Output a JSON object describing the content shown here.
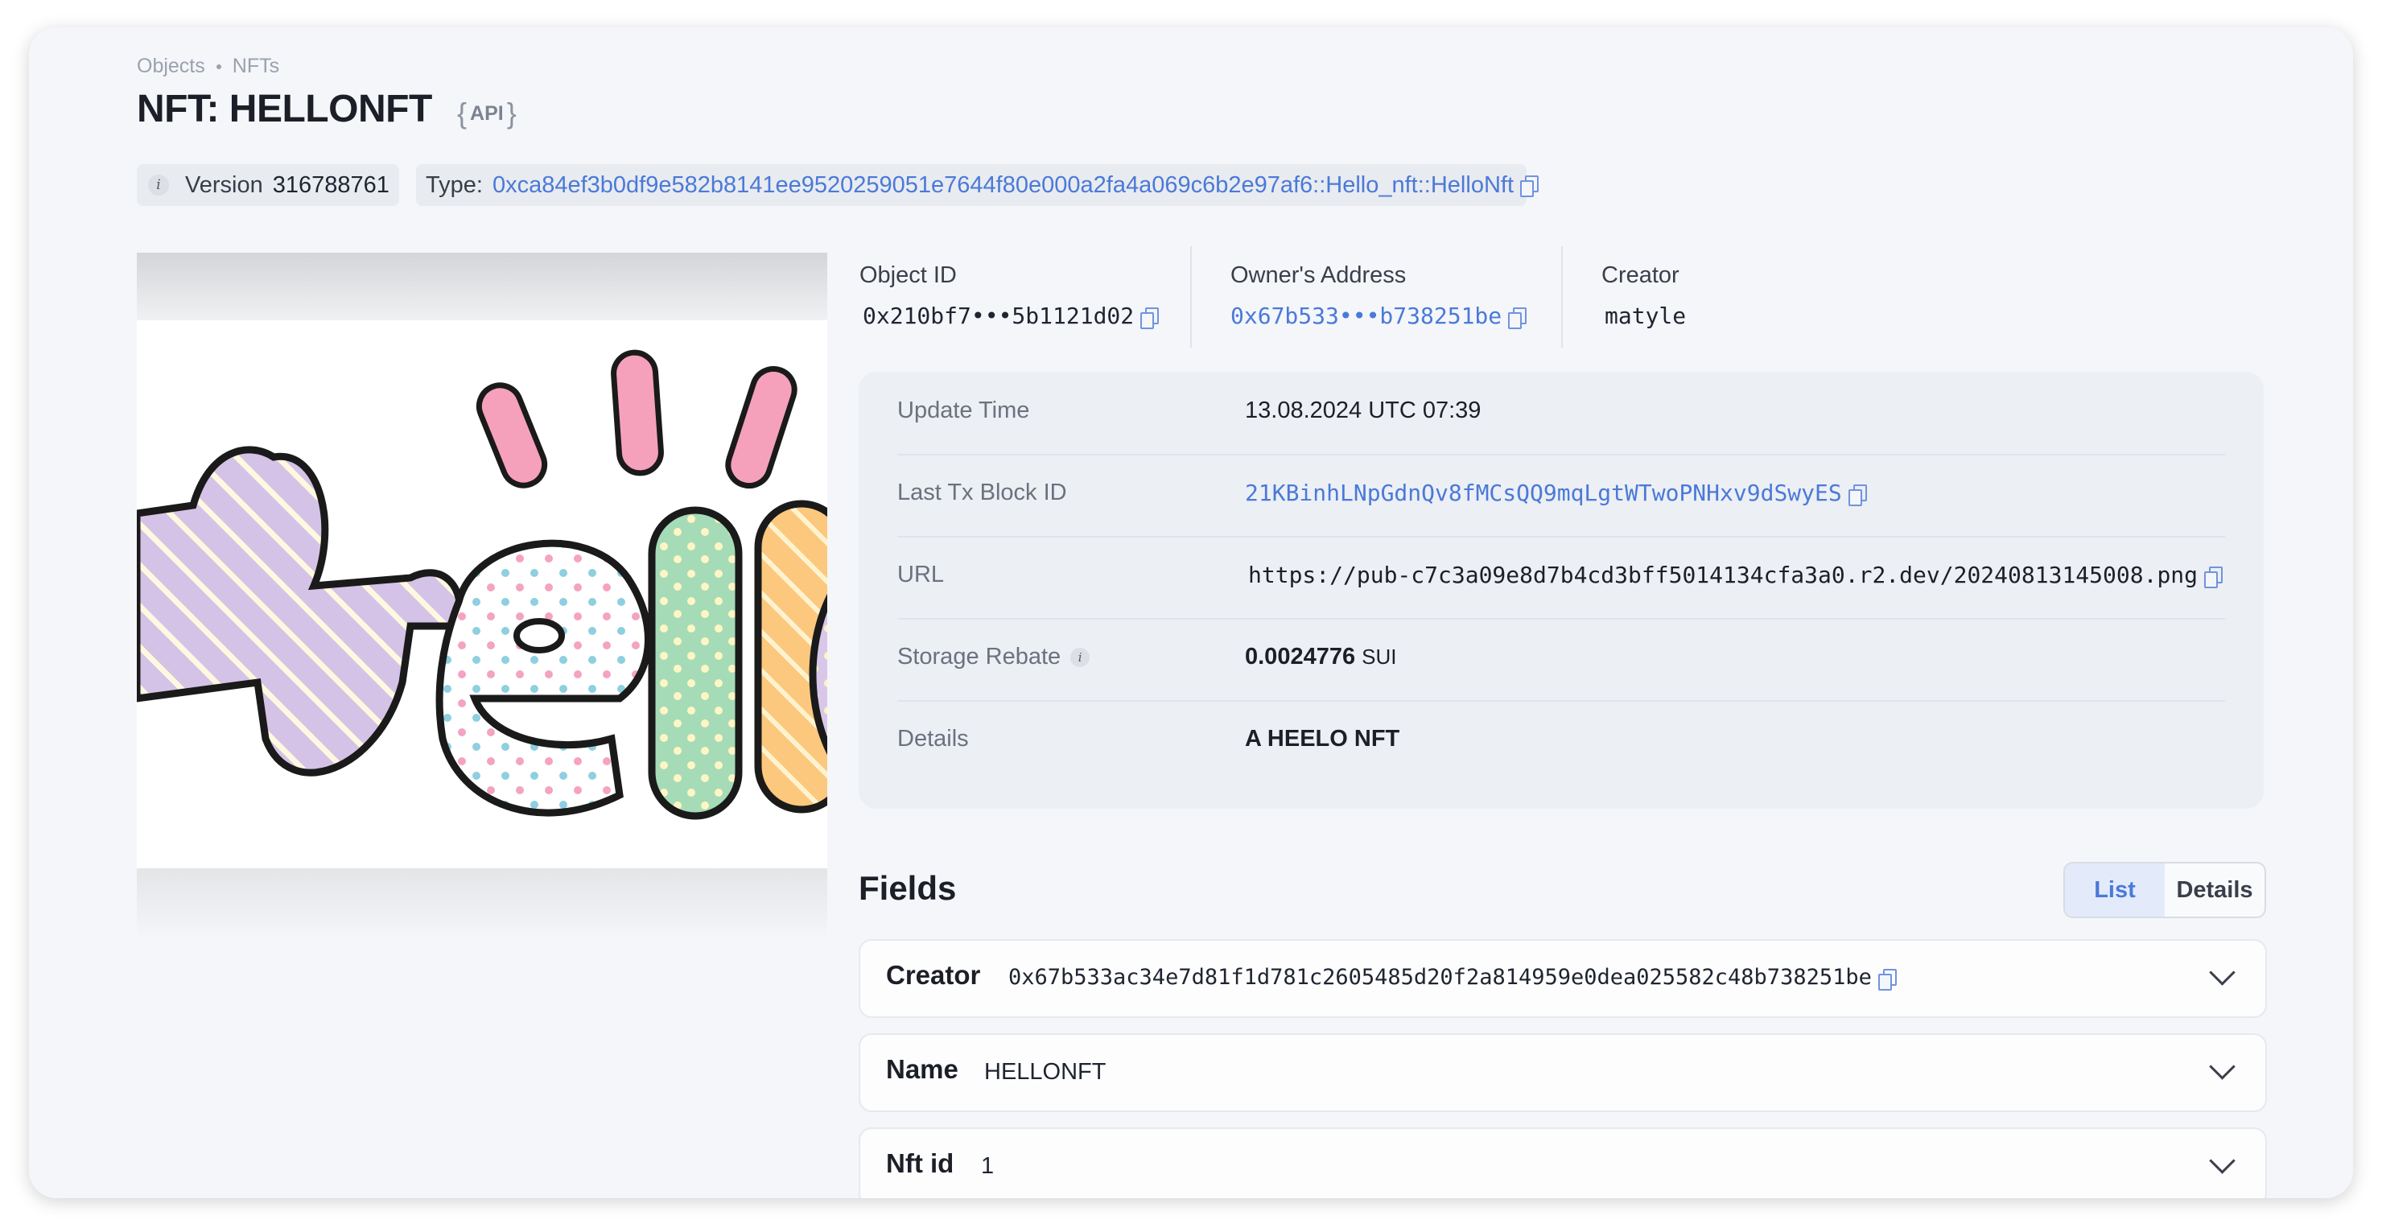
{
  "breadcrumb": {
    "items": [
      "Objects",
      "NFTs"
    ]
  },
  "page": {
    "title": "NFT: HELLONFT",
    "api_label": "API"
  },
  "version": {
    "label": "Version",
    "value": "316788761"
  },
  "type": {
    "label": "Type:",
    "value": "0xca84ef3b0df9e582b8141ee9520259051e7644f80e000a2fa4a069c6b2e97af6::Hello_nft::HelloNft"
  },
  "summary": {
    "object_id": {
      "label": "Object ID",
      "value": "0x210bf7•••5b1121d02"
    },
    "owner": {
      "label": "Owner's Address",
      "value": "0x67b533•••b738251be"
    },
    "creator": {
      "label": "Creator",
      "value": "matyle"
    }
  },
  "details": {
    "update_time": {
      "label": "Update Time",
      "value": "13.08.2024 UTC 07:39"
    },
    "last_tx": {
      "label": "Last Tx Block ID",
      "value": "21KBinhLNpGdnQv8fMCsQQ9mqLgtWTwoPNHxv9dSwyES"
    },
    "url": {
      "label": "URL",
      "value": "https://pub-c7c3a09e8d7b4cd3bff5014134cfa3a0.r2.dev/20240813145008.png"
    },
    "storage_rebate": {
      "label": "Storage Rebate",
      "value": "0.0024776",
      "unit": "SUI"
    },
    "details": {
      "label": "Details",
      "value": "A HEELO NFT"
    }
  },
  "fields": {
    "title": "Fields",
    "toggle": {
      "list": "List",
      "details": "Details",
      "selected": "List"
    },
    "items": [
      {
        "key": "Creator",
        "value": "0x67b533ac34e7d81f1d781c2605485d20f2a814959e0dea025582c48b738251be"
      },
      {
        "key": "Name",
        "value": "HELLONFT"
      },
      {
        "key": "Nft id",
        "value": "1"
      }
    ]
  },
  "icons": [
    "info-icon",
    "copy-icon",
    "chevron-down-icon"
  ],
  "colors": {
    "link": "#4b79d8",
    "background": "#f4f6fa",
    "panel": "#eceff4"
  }
}
